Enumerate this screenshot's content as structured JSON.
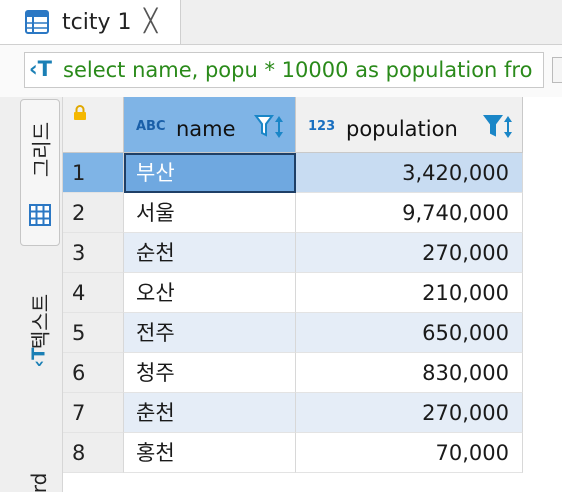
{
  "tab": {
    "title": "tcity 1",
    "close_glyph": "╳"
  },
  "query": {
    "icon_glyph": "‹T",
    "text": "select name, popu * 10000 as population fro"
  },
  "sidebar": {
    "grid_label": "그리드",
    "text_label": "텍스트",
    "record_label": "rd"
  },
  "grid": {
    "columns": [
      {
        "type_badge": "ABC",
        "label": "name"
      },
      {
        "type_badge": "123",
        "label": "population"
      }
    ],
    "rows": [
      {
        "num": "1",
        "name": "부산",
        "population": "3,420,000"
      },
      {
        "num": "2",
        "name": "서울",
        "population": "9,740,000"
      },
      {
        "num": "3",
        "name": "순천",
        "population": "270,000"
      },
      {
        "num": "4",
        "name": "오산",
        "population": "210,000"
      },
      {
        "num": "5",
        "name": "전주",
        "population": "650,000"
      },
      {
        "num": "6",
        "name": "청주",
        "population": "830,000"
      },
      {
        "num": "7",
        "name": "춘천",
        "population": "270,000"
      },
      {
        "num": "8",
        "name": "홍천",
        "population": "70,000"
      }
    ]
  },
  "colors": {
    "accent": "#7fb4e6",
    "selected_cell": "#6fa8e0",
    "alt_row": "#e5edf7",
    "query_text": "#2a8a1a"
  }
}
